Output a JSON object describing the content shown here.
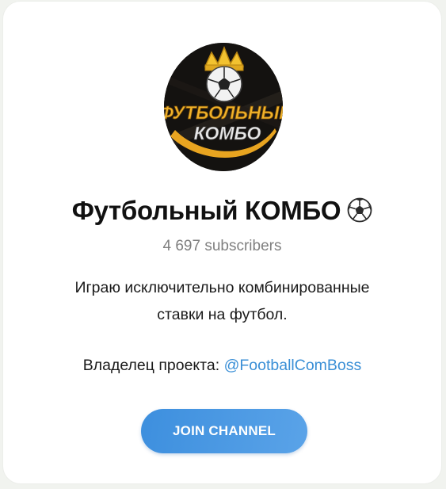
{
  "channel": {
    "avatar_text_line1": "ФУТБОЛЬНЫЙ",
    "avatar_text_line2": "КОМБО",
    "title": "Футбольный КОМБО",
    "title_emoji": "soccer-ball-icon",
    "subscribers": "4 697 subscribers",
    "description_line1": "Играю исключительно комбинированные",
    "description_line2": "ставки на футбол.",
    "owner_label": "Владелец проекта: ",
    "owner_link": "@FootballComBoss",
    "join_label": "JOIN CHANNEL"
  },
  "colors": {
    "accent": "#3d8fde",
    "link": "#3a8fd6",
    "subtitle": "#7f7f7f",
    "logo_gold": "#e8a420"
  }
}
